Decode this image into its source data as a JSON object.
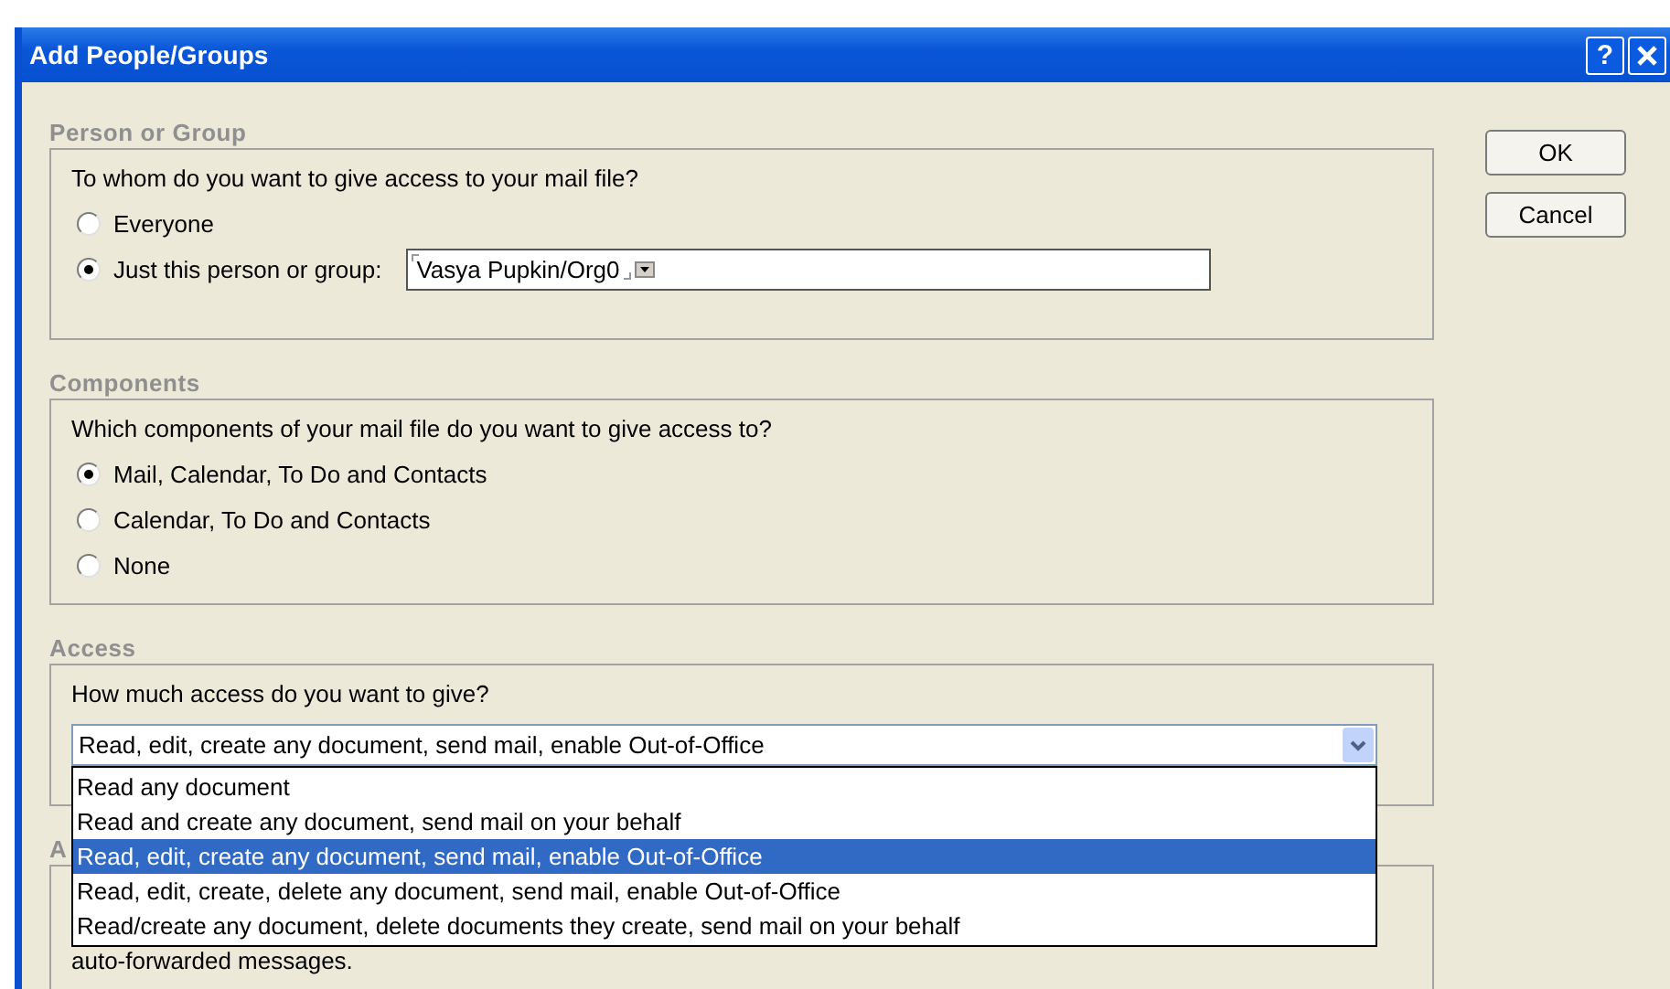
{
  "window": {
    "title": "Add People/Groups",
    "help_button": "?"
  },
  "person_or_group": {
    "label": "Person or Group",
    "question": "To whom do you want to give access to your mail file?",
    "options": [
      {
        "label": "Everyone",
        "selected": false
      },
      {
        "label": "Just this person or group:",
        "selected": true
      }
    ],
    "field_value": "Vasya Pupkin/Org0"
  },
  "components": {
    "label": "Components",
    "question": "Which components of your mail file do you want to give access to?",
    "options": [
      {
        "label": "Mail, Calendar, To Do and Contacts",
        "selected": true
      },
      {
        "label": "Calendar, To Do and Contacts",
        "selected": false
      },
      {
        "label": "None",
        "selected": false
      }
    ]
  },
  "access": {
    "label": "Access",
    "question": "How much access do you want to give?",
    "dropdown": {
      "value": "Read, edit, create any document, send mail, enable Out-of-Office",
      "expanded": true,
      "options": [
        {
          "label": "Read any document",
          "selected": false
        },
        {
          "label": "Read and create any document, send mail on your behalf",
          "selected": false
        },
        {
          "label": "Read, edit, create any document, send mail, enable Out-of-Office",
          "selected": true
        },
        {
          "label": "Read, edit, create, delete any document, send mail, enable Out-of-Office",
          "selected": false
        },
        {
          "label": "Read/create any document, delete documents they create, send mail on your behalf",
          "selected": false
        }
      ]
    }
  },
  "section_4": {
    "label": "A",
    "text": "auto-forwarded messages."
  },
  "buttons": [
    "OK",
    "Cancel"
  ]
}
